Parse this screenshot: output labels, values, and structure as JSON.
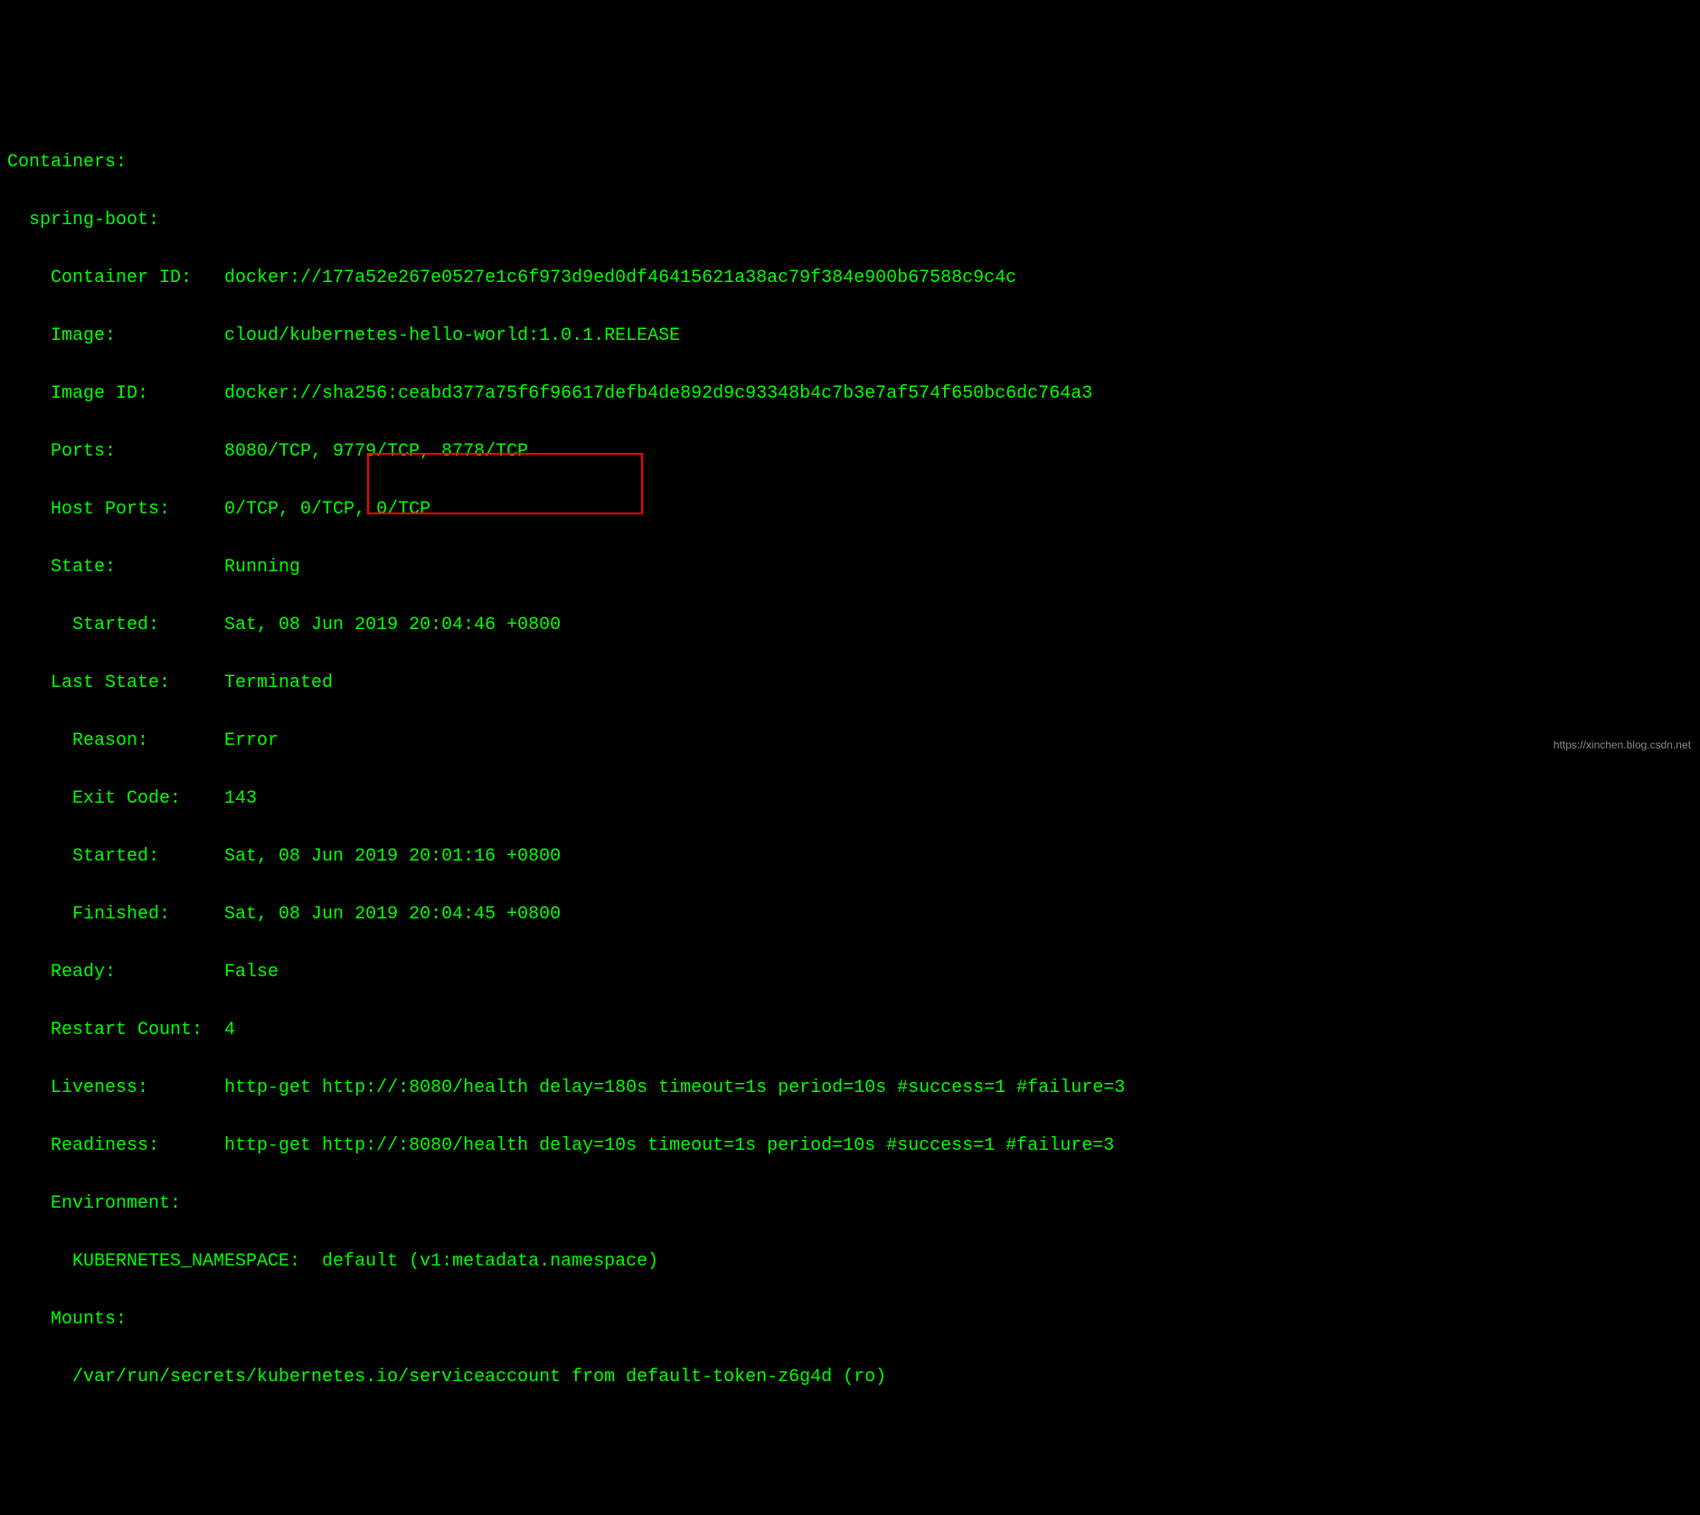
{
  "lines": {
    "l0": "Containers:",
    "l1": "  spring-boot:",
    "l2": "    Container ID:   docker://177a52e267e0527e1c6f973d9ed0df46415621a38ac79f384e900b67588c9c4c",
    "l3": "    Image:          cloud/kubernetes-hello-world:1.0.1.RELEASE",
    "l4": "    Image ID:       docker://sha256:ceabd377a75f6f96617defb4de892d9c93348b4c7b3e7af574f650bc6dc764a3",
    "l5": "    Ports:          8080/TCP, 9779/TCP, 8778/TCP",
    "l6": "    Host Ports:     0/TCP, 0/TCP, 0/TCP",
    "l7": "    State:          Running",
    "l8": "      Started:      Sat, 08 Jun 2019 20:04:46 +0800",
    "l9": "    Last State:     Terminated",
    "l10": "      Reason:       Error",
    "l11": "      Exit Code:    143",
    "l12": "      Started:      Sat, 08 Jun 2019 20:01:16 +0800",
    "l13": "      Finished:     Sat, 08 Jun 2019 20:04:45 +0800",
    "l14": "    Ready:          False",
    "l15": "    Restart Count:  4",
    "l16": "    Liveness:       http-get http://:8080/health delay=180s timeout=1s period=10s #success=1 #failure=3",
    "l17": "    Readiness:      http-get http://:8080/health delay=10s timeout=1s period=10s #success=1 #failure=3",
    "l18": "    Environment:",
    "l19": "      KUBERNETES_NAMESPACE:  default (v1:metadata.namespace)",
    "l20": "    Mounts:",
    "l21": "      /var/run/secrets/kubernetes.io/serviceaccount from default-token-z6g4d (ro)"
  },
  "highlight": {
    "left": "406",
    "top": "501",
    "width": "305",
    "height": "68"
  },
  "watermark": "https://xinchen.blog.csdn.net"
}
